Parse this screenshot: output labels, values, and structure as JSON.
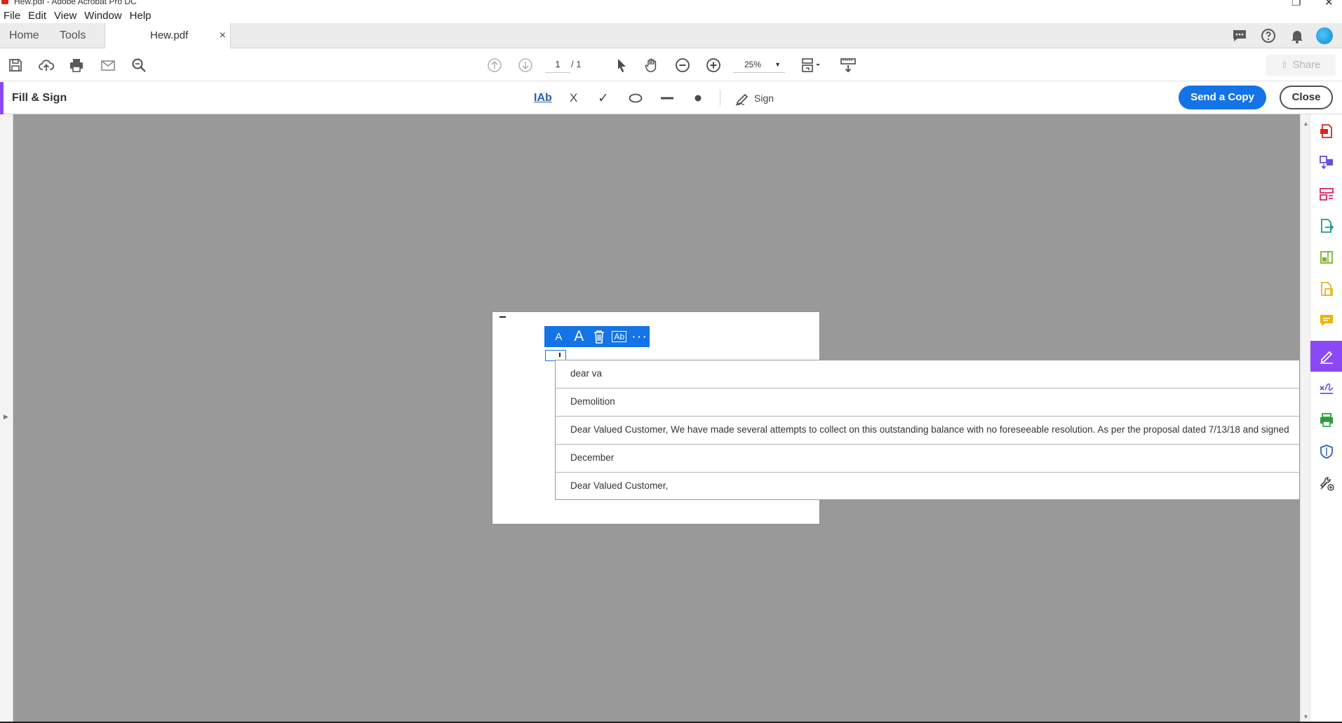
{
  "window": {
    "title": "Hew.pdf - Adobe Acrobat Pro DC",
    "restore_glyph": "❐",
    "close_glyph": "✕"
  },
  "menu": {
    "items": [
      "File",
      "Edit",
      "View",
      "Window",
      "Help"
    ]
  },
  "tabs": {
    "home": "Home",
    "tools": "Tools",
    "document": "Hew.pdf",
    "close_glyph": "×",
    "right_icons": [
      "chat-icon",
      "help-icon",
      "bell-icon",
      "avatar"
    ]
  },
  "toolbar": {
    "icons": [
      "save-icon",
      "cloud-upload-icon",
      "print-icon",
      "mail-icon",
      "search-icon",
      "prev-page-icon",
      "next-page-icon",
      "select-arrow-icon",
      "hand-icon",
      "zoom-out-icon",
      "zoom-in-icon",
      "page-layout-icon",
      "scroll-mode-icon"
    ],
    "page_current": "1",
    "page_total": "/ 1",
    "zoom": "25%",
    "share_label": "Share"
  },
  "fill_sign": {
    "title": "Fill & Sign",
    "text_tool": "IAb",
    "cross_glyph": "X",
    "check_glyph": "✓",
    "sign_label": "Sign",
    "send_copy_label": "Send a Copy",
    "close_label": "Close",
    "accent_color": "#8b49f5",
    "primary_color": "#1473e6"
  },
  "field_toolbar": {
    "small_a": "A",
    "big_a": "A",
    "ab_box": "Ab",
    "more": "···"
  },
  "autocomplete": {
    "items": [
      "dear va",
      "Demolition",
      "Dear Valued Customer,  We have made several attempts to collect on this outstanding balance with no foreseeable resolution.  As per the proposal dated 7/13/18 and signed",
      "December",
      "Dear Valued Customer,"
    ]
  },
  "right_panel": {
    "icons": [
      "create-pdf-icon",
      "combine-files-icon",
      "organize-pages-icon",
      "export-pdf-icon",
      "edit-pdf-icon",
      "compress-pdf-icon",
      "comment-icon",
      "fill-sign-icon",
      "request-signature-icon",
      "print-production-icon",
      "protect-icon",
      "more-tools-icon"
    ],
    "active": "fill-sign-icon"
  }
}
